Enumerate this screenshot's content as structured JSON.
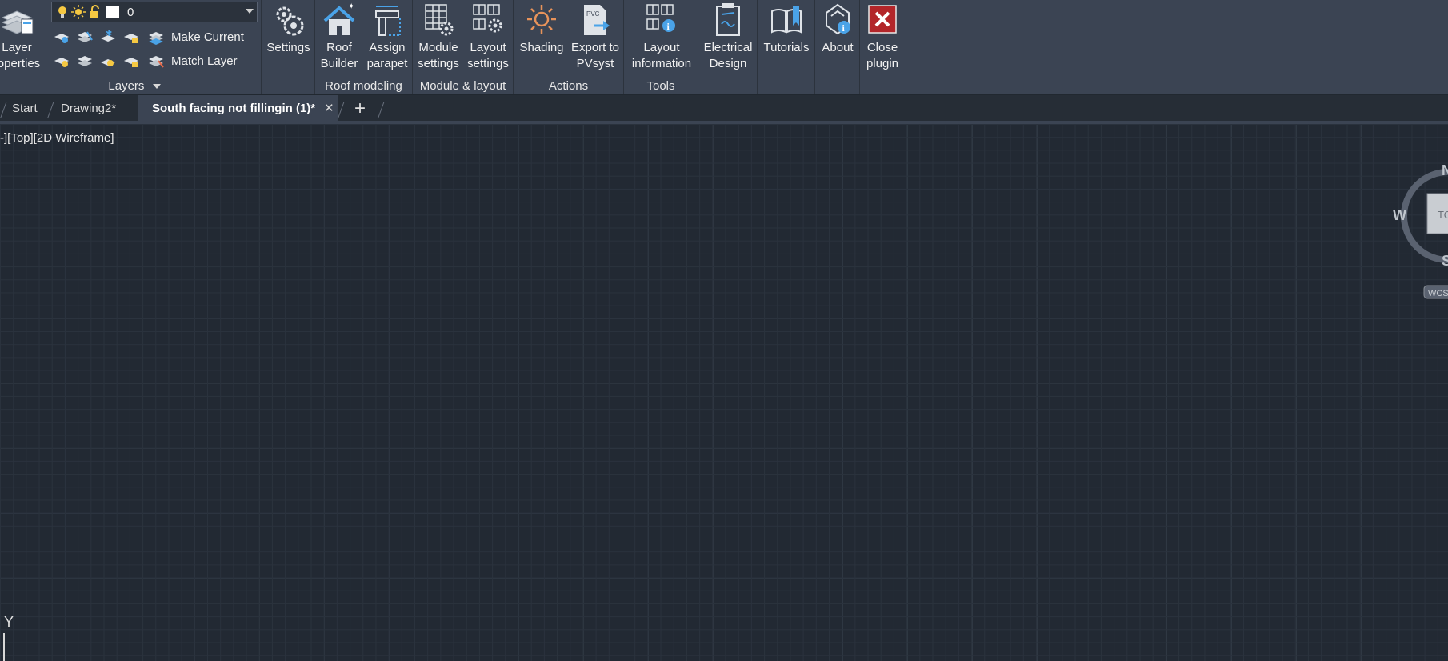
{
  "ribbon": {
    "layers": {
      "layer_properties_label": "Layer\nroperties",
      "current_layer": "0",
      "make_current_label": "Make Current",
      "match_layer_label": "Match Layer",
      "panel_title": "Layers"
    },
    "settings": {
      "label": "Settings"
    },
    "roof_modeling": {
      "roof_builder_label": "Roof\nBuilder",
      "assign_parapet_label": "Assign\nparapet",
      "panel_title": "Roof modeling"
    },
    "module_layout": {
      "module_settings_label": "Module\nsettings",
      "layout_settings_label": "Layout\nsettings",
      "panel_title": "Module & layout"
    },
    "actions": {
      "shading_label": "Shading",
      "export_label": "Export to\nPVsyst",
      "panel_title": "Actions"
    },
    "tools": {
      "layout_information_label": "Layout\ninformation",
      "panel_title": "Tools"
    },
    "electrical_design_label": "Electrical\nDesign",
    "tutorials_label": "Tutorials",
    "about_label": "About",
    "close_plugin_label": "Close\nplugin"
  },
  "tabs": [
    {
      "label": "Start"
    },
    {
      "label": "Drawing2*"
    },
    {
      "label": "South facing not fillingin (1)*"
    }
  ],
  "tab_close_glyph": "✕",
  "tab_add_glyph": "+",
  "viewport": {
    "label": "-][Top][2D Wireframe]"
  },
  "ucs": {
    "y_label": "Y"
  },
  "viewcube": {
    "north": "N",
    "west": "W",
    "south": "S",
    "face": "TO",
    "wcs": "WCS"
  },
  "colors": {
    "ribbon_bg": "#3b4453",
    "canvas_bg": "#222933",
    "close_red": "#b3262a",
    "accent_blue": "#4aa3e8"
  }
}
